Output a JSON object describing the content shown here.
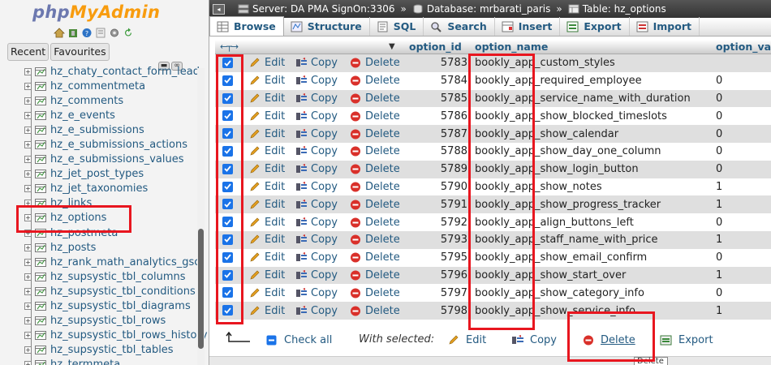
{
  "logo": {
    "php": "php",
    "my": "MyAdmin"
  },
  "nav": {
    "tabs": [
      "Recent",
      "Favourites"
    ],
    "tables": [
      "hz_chaty_contact_form_lead",
      "hz_commentmeta",
      "hz_comments",
      "hz_e_events",
      "hz_e_submissions",
      "hz_e_submissions_actions",
      "hz_e_submissions_values",
      "hz_jet_post_types",
      "hz_jet_taxonomies",
      "hz_links",
      "hz_options",
      "hz_postmeta",
      "hz_posts",
      "hz_rank_math_analytics_gsc",
      "hz_supsystic_tbl_columns",
      "hz_supsystic_tbl_conditions",
      "hz_supsystic_tbl_diagrams",
      "hz_supsystic_tbl_rows",
      "hz_supsystic_tbl_rows_history",
      "hz_supsystic_tbl_tables",
      "hz_termmeta"
    ]
  },
  "breadcrumb": {
    "server": "Server: DA PMA SignOn:3306",
    "database": "Database: mrbarati_paris",
    "table": "Table: hz_options"
  },
  "tabs": [
    {
      "label": "Browse",
      "icon": "browse-icon"
    },
    {
      "label": "Structure",
      "icon": "structure-icon"
    },
    {
      "label": "SQL",
      "icon": "sql-icon"
    },
    {
      "label": "Search",
      "icon": "search-icon"
    },
    {
      "label": "Insert",
      "icon": "insert-icon"
    },
    {
      "label": "Export",
      "icon": "export-icon"
    },
    {
      "label": "Import",
      "icon": "import-icon"
    }
  ],
  "table": {
    "columns": [
      "option_id",
      "option_name",
      "option_value"
    ],
    "actions": {
      "edit": "Edit",
      "copy": "Copy",
      "delete": "Delete"
    },
    "rows": [
      {
        "option_id": "5783",
        "option_name": "bookly_app_custom_styles",
        "option_value": ""
      },
      {
        "option_id": "5784",
        "option_name": "bookly_app_required_employee",
        "option_value": "0"
      },
      {
        "option_id": "5785",
        "option_name": "bookly_app_service_name_with_duration",
        "option_value": "0"
      },
      {
        "option_id": "5786",
        "option_name": "bookly_app_show_blocked_timeslots",
        "option_value": "0"
      },
      {
        "option_id": "5787",
        "option_name": "bookly_app_show_calendar",
        "option_value": "0"
      },
      {
        "option_id": "5788",
        "option_name": "bookly_app_show_day_one_column",
        "option_value": "0"
      },
      {
        "option_id": "5789",
        "option_name": "bookly_app_show_login_button",
        "option_value": "0"
      },
      {
        "option_id": "5790",
        "option_name": "bookly_app_show_notes",
        "option_value": "1"
      },
      {
        "option_id": "5791",
        "option_name": "bookly_app_show_progress_tracker",
        "option_value": "1"
      },
      {
        "option_id": "5792",
        "option_name": "bookly_app_align_buttons_left",
        "option_value": "0"
      },
      {
        "option_id": "5793",
        "option_name": "bookly_app_staff_name_with_price",
        "option_value": "1"
      },
      {
        "option_id": "5795",
        "option_name": "bookly_app_show_email_confirm",
        "option_value": "0"
      },
      {
        "option_id": "5796",
        "option_name": "bookly_app_show_start_over",
        "option_value": "1"
      },
      {
        "option_id": "5797",
        "option_name": "bookly_app_show_category_info",
        "option_value": "0"
      },
      {
        "option_id": "5798",
        "option_name": "bookly_app_show_service_info",
        "option_value": "1"
      }
    ]
  },
  "bottom": {
    "check_all": "Check all",
    "with_selected": "With selected:",
    "edit": "Edit",
    "copy": "Copy",
    "delete": "Delete",
    "export": "Export",
    "tooltip": "Delete"
  },
  "colors": {
    "highlight": "#e8161f",
    "link": "#235a81",
    "checkbox": "#1a73e8"
  }
}
